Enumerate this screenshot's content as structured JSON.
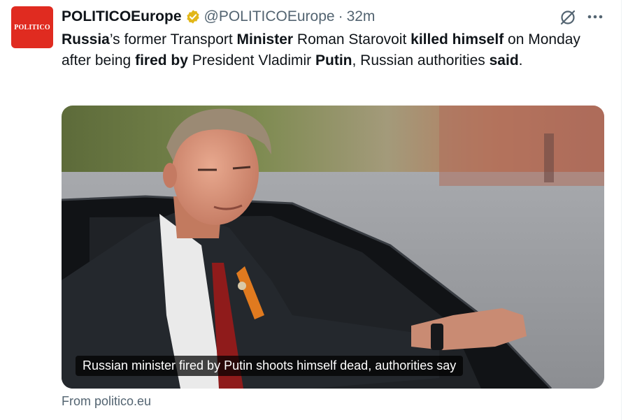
{
  "author": {
    "avatar_text": "POLITICO",
    "display_name": "POLITICOEurope",
    "handle": "@POLITICOEurope",
    "separator": "·",
    "time": "32m",
    "verified_icon": "gold-verified-badge-icon"
  },
  "actions": {
    "grok_icon": "grok-slash-icon",
    "more_icon": "more-horizontal-icon"
  },
  "tweet": {
    "segments": [
      {
        "text": "Russia",
        "bold": true
      },
      {
        "text": "’s former Transport ",
        "bold": false
      },
      {
        "text": "Minister",
        "bold": true
      },
      {
        "text": " Roman Starovoit ",
        "bold": false
      },
      {
        "text": "killed himself",
        "bold": true
      },
      {
        "text": " on Monday after being ",
        "bold": false
      },
      {
        "text": "fired by",
        "bold": true
      },
      {
        "text": " President Vladimir ",
        "bold": false
      },
      {
        "text": "Putin",
        "bold": true
      },
      {
        "text": ", Russian authorities ",
        "bold": false
      },
      {
        "text": "said",
        "bold": true
      },
      {
        "text": ".",
        "bold": false
      }
    ]
  },
  "card": {
    "caption": "Russian minister fired by Putin shoots himself dead, authorities say",
    "source": "From politico.eu"
  },
  "colors": {
    "brand": "#e02b20",
    "verified": "#e2b719",
    "muted": "#536471",
    "text": "#0f1419"
  }
}
